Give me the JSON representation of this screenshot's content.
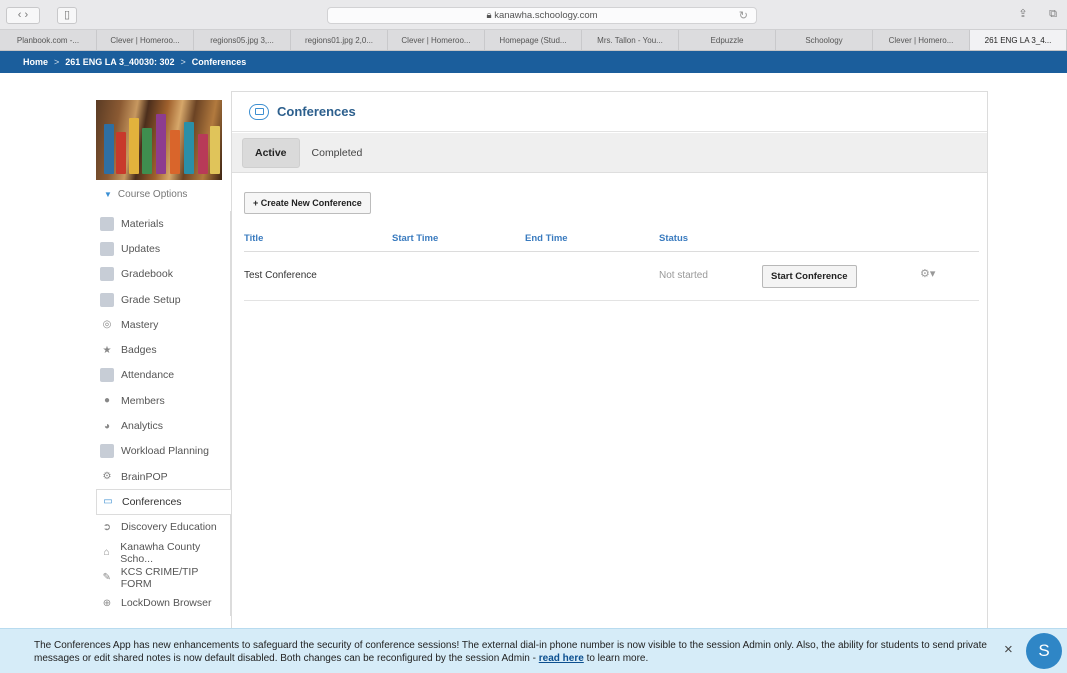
{
  "browser": {
    "url": "kanawha.schoology.com",
    "tabs": [
      {
        "label": "Planbook.com -..."
      },
      {
        "label": "Clever | Homeroo..."
      },
      {
        "label": "regions05.jpg 3,..."
      },
      {
        "label": "regions01.jpg 2,0..."
      },
      {
        "label": "Clever | Homeroo..."
      },
      {
        "label": "Homepage (Stud..."
      },
      {
        "label": "Mrs. Tallon - You..."
      },
      {
        "label": "Edpuzzle"
      },
      {
        "label": "Schoology"
      },
      {
        "label": "Clever | Homero..."
      },
      {
        "label": "261 ENG LA 3_4..."
      }
    ]
  },
  "breadcrumb": {
    "home": "Home",
    "sep": ">",
    "course": "261 ENG LA 3_40030: 302",
    "current": "Conferences"
  },
  "sidebar": {
    "course_options": "Course Options",
    "items": [
      {
        "label": "Materials",
        "icon": "materials-icon"
      },
      {
        "label": "Updates",
        "icon": "updates-icon"
      },
      {
        "label": "Gradebook",
        "icon": "gradebook-icon"
      },
      {
        "label": "Grade Setup",
        "icon": "grade-setup-icon"
      },
      {
        "label": "Mastery",
        "icon": "mastery-icon"
      },
      {
        "label": "Badges",
        "icon": "badges-icon"
      },
      {
        "label": "Attendance",
        "icon": "attendance-icon"
      },
      {
        "label": "Members",
        "icon": "members-icon"
      },
      {
        "label": "Analytics",
        "icon": "analytics-icon"
      },
      {
        "label": "Workload Planning",
        "icon": "workload-icon"
      },
      {
        "label": "BrainPOP",
        "icon": "brainpop-icon"
      },
      {
        "label": "Conferences",
        "icon": "conferences-icon"
      },
      {
        "label": "Discovery Education",
        "icon": "discovery-icon"
      },
      {
        "label": "Kanawha County Scho...",
        "icon": "kanawha-icon"
      },
      {
        "label": "KCS CRIME/TIP FORM",
        "icon": "crime-tip-icon"
      },
      {
        "label": "LockDown Browser",
        "icon": "lockdown-icon"
      }
    ]
  },
  "main": {
    "title": "Conferences",
    "tabs": [
      "Active",
      "Completed"
    ],
    "create_button": "+ Create New Conference",
    "columns": [
      "Title",
      "Start Time",
      "End Time",
      "Status"
    ],
    "rows": [
      {
        "title": "Test Conference",
        "start_time": "",
        "end_time": "",
        "status": "Not started",
        "action": "Start Conference"
      }
    ]
  },
  "notice": {
    "text": "The Conferences App has new enhancements to safeguard the security of conference sessions! The external dial-in phone number is now visible to the session Admin only. Also, the ability for students to send private messages or edit shared notes is now default disabled. Both changes can be reconfigured by the session Admin -",
    "link": "read here",
    "suffix": "to learn more.",
    "close": "×",
    "badge": "S"
  }
}
